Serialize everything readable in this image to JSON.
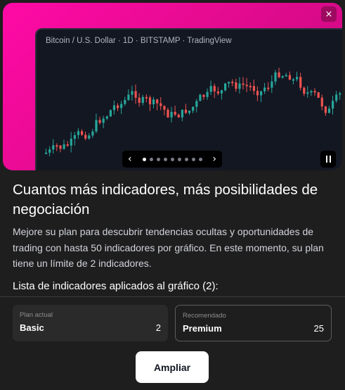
{
  "hero": {
    "close_icon": "×",
    "chart_caption": "Bitcoin / U.S. Dollar · 1D · BITSTAMP · TradingView",
    "carousel": {
      "prev_icon": "‹",
      "next_icon": "›",
      "slide_count": 9,
      "active_index": 0
    },
    "colors": {
      "up": "#26a69a",
      "down": "#ef5350",
      "background": "#131722",
      "accent": "#ff0aa6"
    }
  },
  "content": {
    "headline": "Cuantos más indicadores, más posibilidades de negociación",
    "description": "Mejore su plan para descubrir tendencias ocultas y oportunidades de trading con hasta 50 indicadores por gráfico. En este momento, su plan tiene un límite de 2 indicadores.",
    "list_title": "Lista de indicadores aplicados al gráfico (2):"
  },
  "plans": {
    "current": {
      "caption": "Plan actual",
      "name": "Basic",
      "value": "2"
    },
    "recommended": {
      "caption": "Recomendado",
      "name": "Premium",
      "value": "25"
    }
  },
  "actions": {
    "upgrade_label": "Ampliar"
  }
}
